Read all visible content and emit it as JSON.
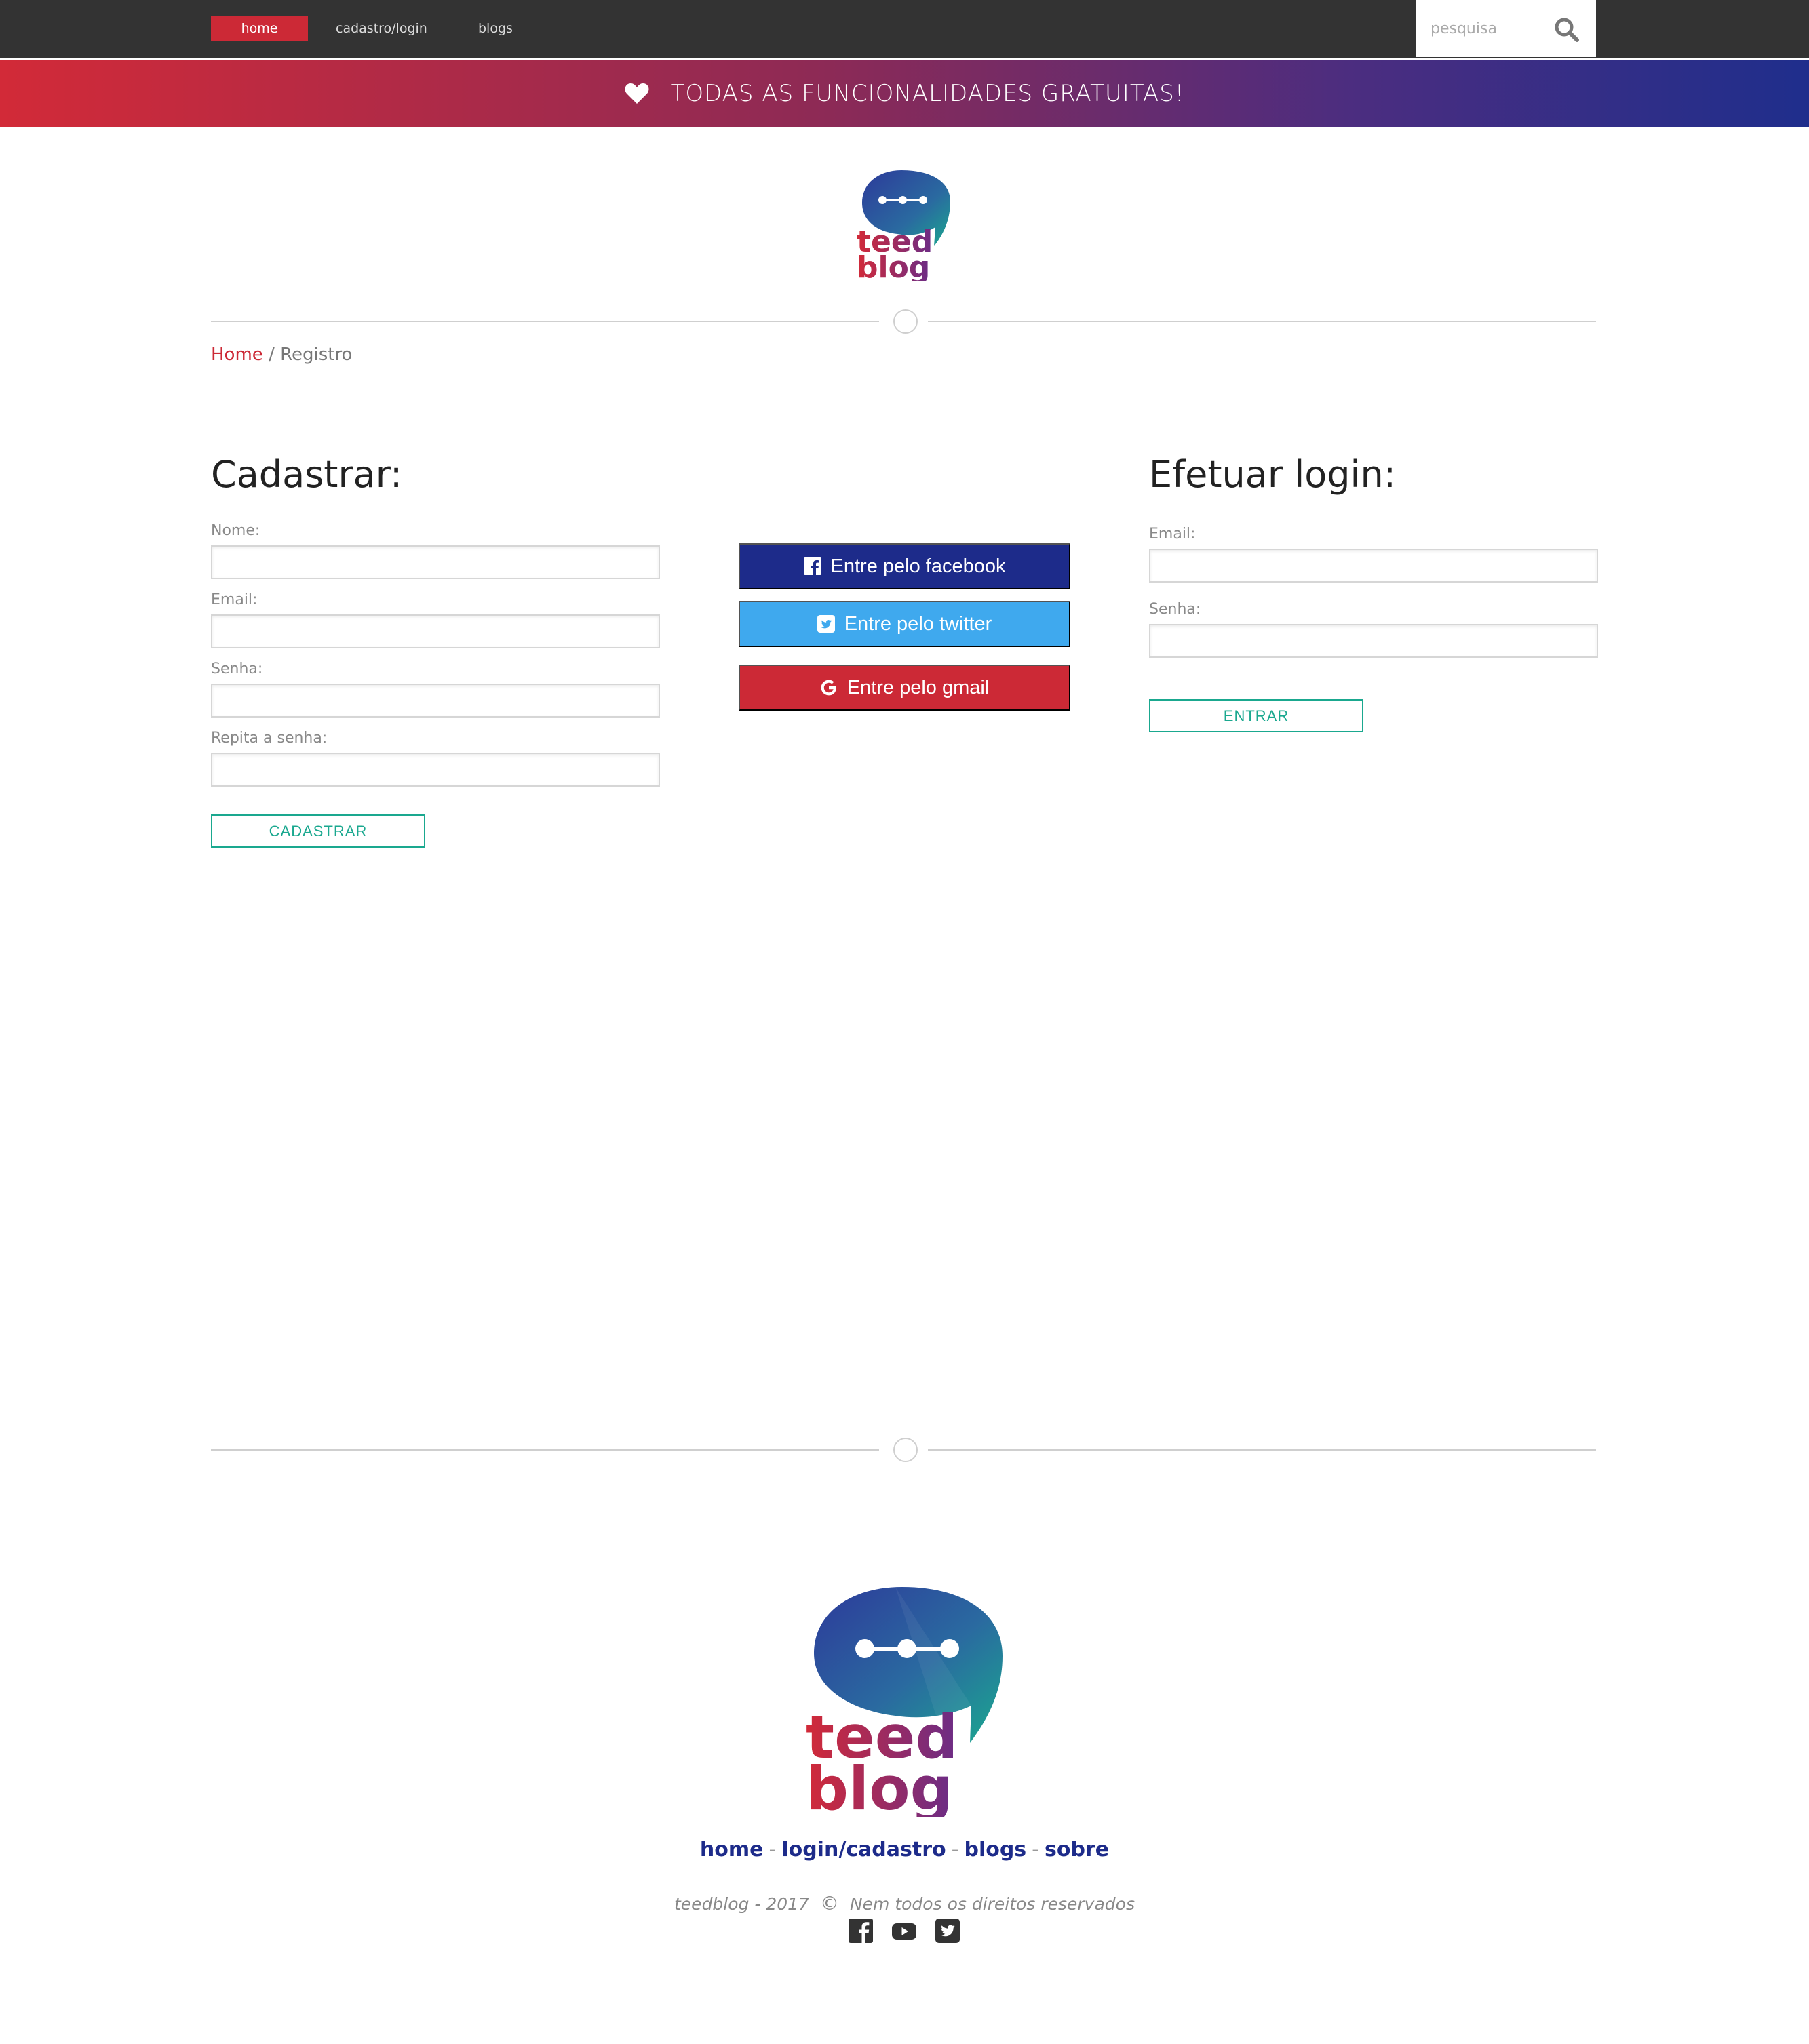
{
  "nav": {
    "home": "home",
    "cadastro_login": "cadastro/login",
    "blogs": "blogs",
    "search_placeholder": "pesquisa"
  },
  "promo": {
    "text": "TODAS AS FUNCIONALIDADES GRATUITAS!"
  },
  "breadcrumb": {
    "home": "Home",
    "separator": " / ",
    "current": "Registro"
  },
  "cadastro": {
    "title": "Cadastrar:",
    "fields": [
      {
        "label": "Nome:",
        "value": ""
      },
      {
        "label": "Email:",
        "value": ""
      },
      {
        "label": "Senha:",
        "value": ""
      },
      {
        "label": "Repita a senha:",
        "value": ""
      }
    ],
    "submit": "CADASTRAR"
  },
  "social": {
    "facebook": "Entre pelo facebook",
    "twitter": "Entre pelo twitter",
    "gmail": "Entre pelo gmail"
  },
  "login": {
    "title": "Efetuar login:",
    "fields": [
      {
        "label": "Email:",
        "value": ""
      },
      {
        "label": "Senha:",
        "value": ""
      }
    ],
    "submit": "ENTRAR"
  },
  "footer": {
    "links": [
      "home",
      "login/cadastro",
      "blogs",
      "sobre"
    ],
    "separator": "-",
    "copyright_left": "teedblog - 2017",
    "copyright_symbol": "©",
    "copyright_right": "Nem todos os direitos reservados",
    "social_icons": [
      "facebook-icon",
      "youtube-icon",
      "twitter-icon"
    ]
  },
  "logo": {
    "line1": "teed",
    "line2": "blog"
  },
  "colors": {
    "brand_red": "#cc2936",
    "brand_blue": "#1d2b8a",
    "twitter_blue": "#3fa9ee",
    "accent_green": "#1aa88f",
    "topbar": "#333333"
  }
}
